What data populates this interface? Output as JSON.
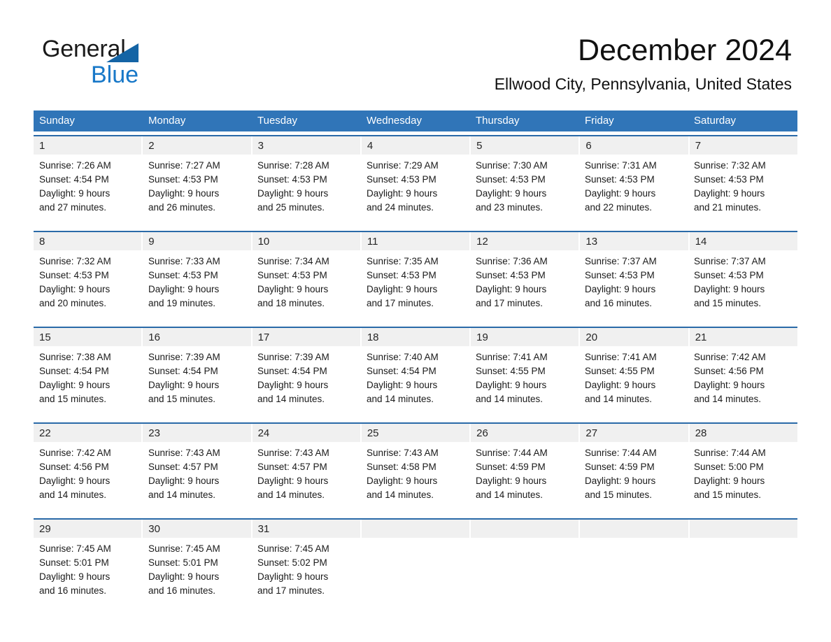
{
  "brand": {
    "name_part1": "General",
    "name_part2": "Blue",
    "triangle_color": "#1464a5",
    "blue_color": "#1878c8"
  },
  "header": {
    "title": "December 2024",
    "location": "Ellwood City, Pennsylvania, United States"
  },
  "theme": {
    "header_bar_color": "#3075b8",
    "row_divider_color": "#2a6aa8",
    "daynum_band_color": "#f0f0f0"
  },
  "calendar": {
    "weekdays": [
      "Sunday",
      "Monday",
      "Tuesday",
      "Wednesday",
      "Thursday",
      "Friday",
      "Saturday"
    ],
    "weeks": [
      [
        {
          "day": "1",
          "sunrise": "Sunrise: 7:26 AM",
          "sunset": "Sunset: 4:54 PM",
          "daylight1": "Daylight: 9 hours",
          "daylight2": "and 27 minutes."
        },
        {
          "day": "2",
          "sunrise": "Sunrise: 7:27 AM",
          "sunset": "Sunset: 4:53 PM",
          "daylight1": "Daylight: 9 hours",
          "daylight2": "and 26 minutes."
        },
        {
          "day": "3",
          "sunrise": "Sunrise: 7:28 AM",
          "sunset": "Sunset: 4:53 PM",
          "daylight1": "Daylight: 9 hours",
          "daylight2": "and 25 minutes."
        },
        {
          "day": "4",
          "sunrise": "Sunrise: 7:29 AM",
          "sunset": "Sunset: 4:53 PM",
          "daylight1": "Daylight: 9 hours",
          "daylight2": "and 24 minutes."
        },
        {
          "day": "5",
          "sunrise": "Sunrise: 7:30 AM",
          "sunset": "Sunset: 4:53 PM",
          "daylight1": "Daylight: 9 hours",
          "daylight2": "and 23 minutes."
        },
        {
          "day": "6",
          "sunrise": "Sunrise: 7:31 AM",
          "sunset": "Sunset: 4:53 PM",
          "daylight1": "Daylight: 9 hours",
          "daylight2": "and 22 minutes."
        },
        {
          "day": "7",
          "sunrise": "Sunrise: 7:32 AM",
          "sunset": "Sunset: 4:53 PM",
          "daylight1": "Daylight: 9 hours",
          "daylight2": "and 21 minutes."
        }
      ],
      [
        {
          "day": "8",
          "sunrise": "Sunrise: 7:32 AM",
          "sunset": "Sunset: 4:53 PM",
          "daylight1": "Daylight: 9 hours",
          "daylight2": "and 20 minutes."
        },
        {
          "day": "9",
          "sunrise": "Sunrise: 7:33 AM",
          "sunset": "Sunset: 4:53 PM",
          "daylight1": "Daylight: 9 hours",
          "daylight2": "and 19 minutes."
        },
        {
          "day": "10",
          "sunrise": "Sunrise: 7:34 AM",
          "sunset": "Sunset: 4:53 PM",
          "daylight1": "Daylight: 9 hours",
          "daylight2": "and 18 minutes."
        },
        {
          "day": "11",
          "sunrise": "Sunrise: 7:35 AM",
          "sunset": "Sunset: 4:53 PM",
          "daylight1": "Daylight: 9 hours",
          "daylight2": "and 17 minutes."
        },
        {
          "day": "12",
          "sunrise": "Sunrise: 7:36 AM",
          "sunset": "Sunset: 4:53 PM",
          "daylight1": "Daylight: 9 hours",
          "daylight2": "and 17 minutes."
        },
        {
          "day": "13",
          "sunrise": "Sunrise: 7:37 AM",
          "sunset": "Sunset: 4:53 PM",
          "daylight1": "Daylight: 9 hours",
          "daylight2": "and 16 minutes."
        },
        {
          "day": "14",
          "sunrise": "Sunrise: 7:37 AM",
          "sunset": "Sunset: 4:53 PM",
          "daylight1": "Daylight: 9 hours",
          "daylight2": "and 15 minutes."
        }
      ],
      [
        {
          "day": "15",
          "sunrise": "Sunrise: 7:38 AM",
          "sunset": "Sunset: 4:54 PM",
          "daylight1": "Daylight: 9 hours",
          "daylight2": "and 15 minutes."
        },
        {
          "day": "16",
          "sunrise": "Sunrise: 7:39 AM",
          "sunset": "Sunset: 4:54 PM",
          "daylight1": "Daylight: 9 hours",
          "daylight2": "and 15 minutes."
        },
        {
          "day": "17",
          "sunrise": "Sunrise: 7:39 AM",
          "sunset": "Sunset: 4:54 PM",
          "daylight1": "Daylight: 9 hours",
          "daylight2": "and 14 minutes."
        },
        {
          "day": "18",
          "sunrise": "Sunrise: 7:40 AM",
          "sunset": "Sunset: 4:54 PM",
          "daylight1": "Daylight: 9 hours",
          "daylight2": "and 14 minutes."
        },
        {
          "day": "19",
          "sunrise": "Sunrise: 7:41 AM",
          "sunset": "Sunset: 4:55 PM",
          "daylight1": "Daylight: 9 hours",
          "daylight2": "and 14 minutes."
        },
        {
          "day": "20",
          "sunrise": "Sunrise: 7:41 AM",
          "sunset": "Sunset: 4:55 PM",
          "daylight1": "Daylight: 9 hours",
          "daylight2": "and 14 minutes."
        },
        {
          "day": "21",
          "sunrise": "Sunrise: 7:42 AM",
          "sunset": "Sunset: 4:56 PM",
          "daylight1": "Daylight: 9 hours",
          "daylight2": "and 14 minutes."
        }
      ],
      [
        {
          "day": "22",
          "sunrise": "Sunrise: 7:42 AM",
          "sunset": "Sunset: 4:56 PM",
          "daylight1": "Daylight: 9 hours",
          "daylight2": "and 14 minutes."
        },
        {
          "day": "23",
          "sunrise": "Sunrise: 7:43 AM",
          "sunset": "Sunset: 4:57 PM",
          "daylight1": "Daylight: 9 hours",
          "daylight2": "and 14 minutes."
        },
        {
          "day": "24",
          "sunrise": "Sunrise: 7:43 AM",
          "sunset": "Sunset: 4:57 PM",
          "daylight1": "Daylight: 9 hours",
          "daylight2": "and 14 minutes."
        },
        {
          "day": "25",
          "sunrise": "Sunrise: 7:43 AM",
          "sunset": "Sunset: 4:58 PM",
          "daylight1": "Daylight: 9 hours",
          "daylight2": "and 14 minutes."
        },
        {
          "day": "26",
          "sunrise": "Sunrise: 7:44 AM",
          "sunset": "Sunset: 4:59 PM",
          "daylight1": "Daylight: 9 hours",
          "daylight2": "and 14 minutes."
        },
        {
          "day": "27",
          "sunrise": "Sunrise: 7:44 AM",
          "sunset": "Sunset: 4:59 PM",
          "daylight1": "Daylight: 9 hours",
          "daylight2": "and 15 minutes."
        },
        {
          "day": "28",
          "sunrise": "Sunrise: 7:44 AM",
          "sunset": "Sunset: 5:00 PM",
          "daylight1": "Daylight: 9 hours",
          "daylight2": "and 15 minutes."
        }
      ],
      [
        {
          "day": "29",
          "sunrise": "Sunrise: 7:45 AM",
          "sunset": "Sunset: 5:01 PM",
          "daylight1": "Daylight: 9 hours",
          "daylight2": "and 16 minutes."
        },
        {
          "day": "30",
          "sunrise": "Sunrise: 7:45 AM",
          "sunset": "Sunset: 5:01 PM",
          "daylight1": "Daylight: 9 hours",
          "daylight2": "and 16 minutes."
        },
        {
          "day": "31",
          "sunrise": "Sunrise: 7:45 AM",
          "sunset": "Sunset: 5:02 PM",
          "daylight1": "Daylight: 9 hours",
          "daylight2": "and 17 minutes."
        },
        {
          "day": "",
          "sunrise": "",
          "sunset": "",
          "daylight1": "",
          "daylight2": ""
        },
        {
          "day": "",
          "sunrise": "",
          "sunset": "",
          "daylight1": "",
          "daylight2": ""
        },
        {
          "day": "",
          "sunrise": "",
          "sunset": "",
          "daylight1": "",
          "daylight2": ""
        },
        {
          "day": "",
          "sunrise": "",
          "sunset": "",
          "daylight1": "",
          "daylight2": ""
        }
      ]
    ]
  }
}
